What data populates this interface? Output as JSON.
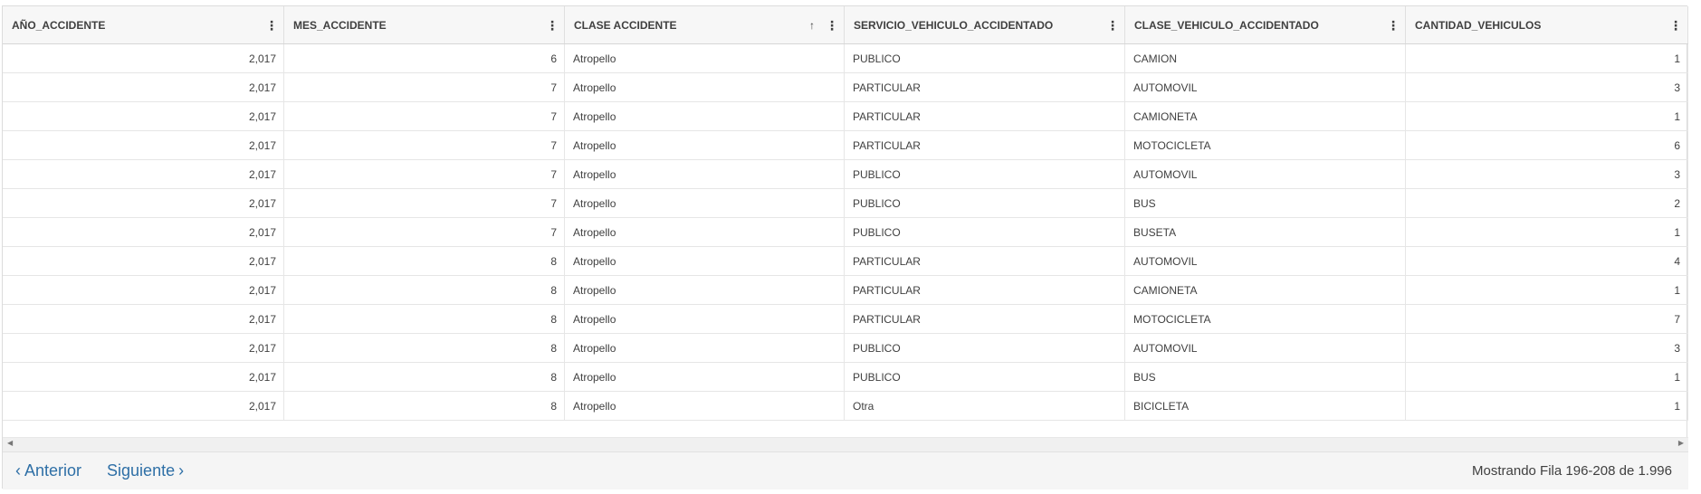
{
  "columns": [
    {
      "label": "AÑO_ACCIDENTE",
      "sorted": false
    },
    {
      "label": "MES_ACCIDENTE",
      "sorted": false
    },
    {
      "label": "CLASE ACCIDENTE",
      "sorted": true,
      "sort_icon": "arrow-up-icon"
    },
    {
      "label": "SERVICIO_VEHICULO_ACCIDENTADO",
      "sorted": false
    },
    {
      "label": "CLASE_VEHICULO_ACCIDENTADO",
      "sorted": false
    },
    {
      "label": "CANTIDAD_VEHICULOS",
      "sorted": false
    }
  ],
  "column_menu_icon": "vertical-ellipsis-icon",
  "rows": [
    [
      "2,017",
      "6",
      "Atropello",
      "PUBLICO",
      "CAMION",
      "1"
    ],
    [
      "2,017",
      "7",
      "Atropello",
      "PARTICULAR",
      "AUTOMOVIL",
      "3"
    ],
    [
      "2,017",
      "7",
      "Atropello",
      "PARTICULAR",
      "CAMIONETA",
      "1"
    ],
    [
      "2,017",
      "7",
      "Atropello",
      "PARTICULAR",
      "MOTOCICLETA",
      "6"
    ],
    [
      "2,017",
      "7",
      "Atropello",
      "PUBLICO",
      "AUTOMOVIL",
      "3"
    ],
    [
      "2,017",
      "7",
      "Atropello",
      "PUBLICO",
      "BUS",
      "2"
    ],
    [
      "2,017",
      "7",
      "Atropello",
      "PUBLICO",
      "BUSETA",
      "1"
    ],
    [
      "2,017",
      "8",
      "Atropello",
      "PARTICULAR",
      "AUTOMOVIL",
      "4"
    ],
    [
      "2,017",
      "8",
      "Atropello",
      "PARTICULAR",
      "CAMIONETA",
      "1"
    ],
    [
      "2,017",
      "8",
      "Atropello",
      "PARTICULAR",
      "MOTOCICLETA",
      "7"
    ],
    [
      "2,017",
      "8",
      "Atropello",
      "PUBLICO",
      "AUTOMOVIL",
      "3"
    ],
    [
      "2,017",
      "8",
      "Atropello",
      "PUBLICO",
      "BUS",
      "1"
    ],
    [
      "2,017",
      "8",
      "Atropello",
      "Otra",
      "BICICLETA",
      "1"
    ]
  ],
  "pager": {
    "prev_label": "Anterior",
    "next_label": "Siguiente",
    "prev_icon": "chevron-left-icon",
    "next_icon": "chevron-right-icon",
    "status": "Mostrando Fila 196-208 de 1.996"
  },
  "colors": {
    "link": "#2e6fa6",
    "header_bg": "#f7f7f7",
    "footer_bg": "#f5f5f5"
  }
}
